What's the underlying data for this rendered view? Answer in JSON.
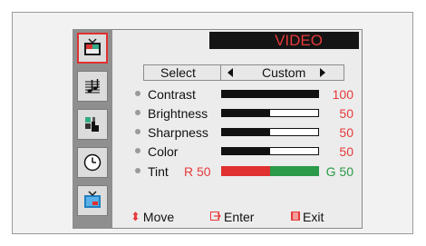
{
  "menu": {
    "title": "VIDEO",
    "select": {
      "label": "Select",
      "value": "Custom"
    },
    "settings": [
      {
        "name": "Contrast",
        "level": 100
      },
      {
        "name": "Brightness",
        "level": 50
      },
      {
        "name": "Sharpness",
        "level": 50
      },
      {
        "name": "Color",
        "level": 50
      }
    ],
    "tint": {
      "name": "Tint",
      "left_value": "R 50",
      "right_value": "G 50",
      "balance": 0.5
    }
  },
  "sidebar": {
    "items": [
      {
        "name": "picture-icon",
        "active": true
      },
      {
        "name": "sound-icon",
        "active": false
      },
      {
        "name": "channel-icon",
        "active": false
      },
      {
        "name": "clock-icon",
        "active": false
      },
      {
        "name": "setup-icon",
        "active": false
      }
    ]
  },
  "footer": {
    "move": "Move",
    "enter": "Enter",
    "exit": "Exit"
  },
  "colors": {
    "accent_red": "#e63a3a",
    "green": "#2a9a48",
    "title_bg": "#141414"
  }
}
